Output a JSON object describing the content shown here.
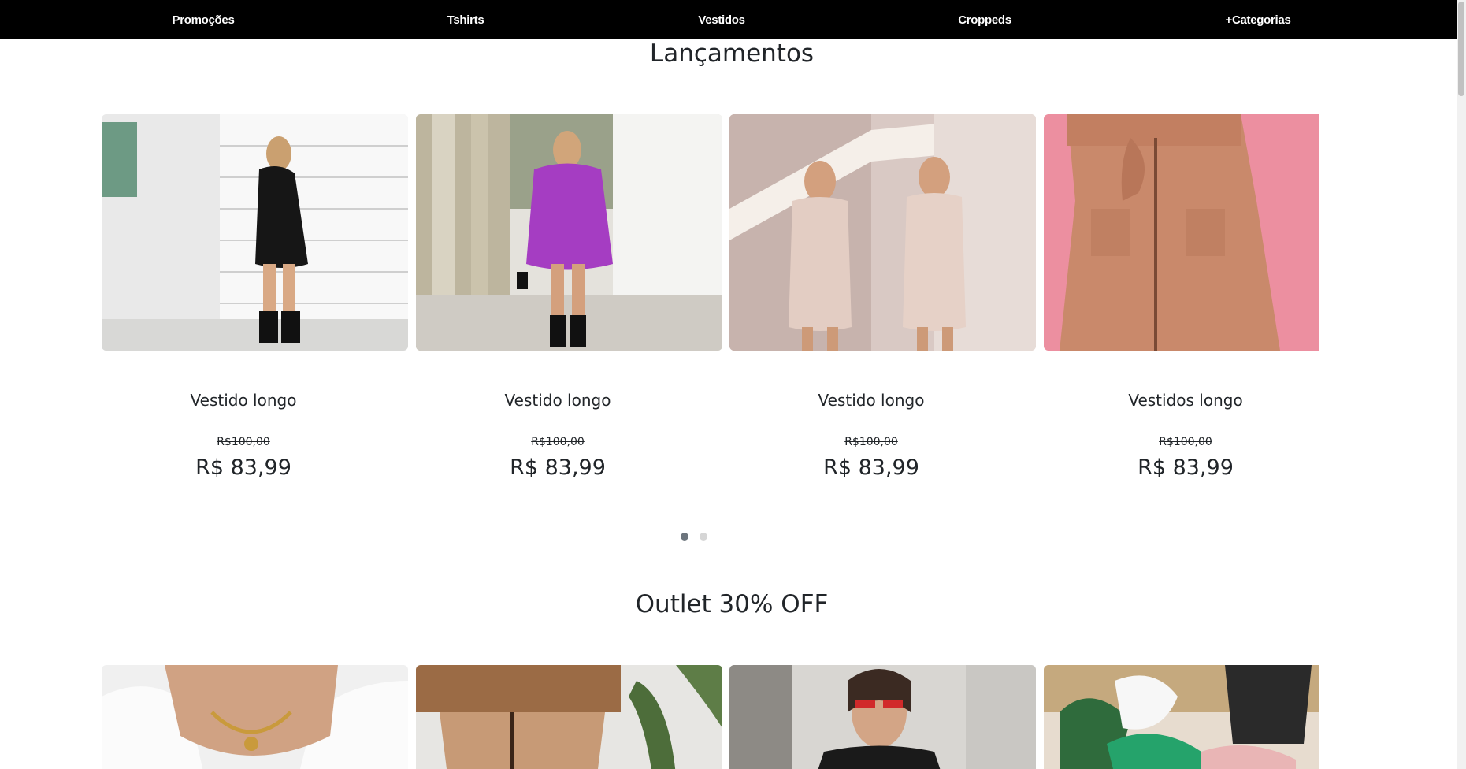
{
  "nav": {
    "items": [
      {
        "label": "Promoções"
      },
      {
        "label": "Tshirts"
      },
      {
        "label": "Vestidos"
      },
      {
        "label": "Croppeds"
      },
      {
        "label": "+Categorias"
      }
    ]
  },
  "launches": {
    "title": "Lançamentos",
    "products": [
      {
        "name": "Vestido longo",
        "old_price": "R$100,00",
        "price": "R$ 83,99"
      },
      {
        "name": "Vestido longo",
        "old_price": "R$100,00",
        "price": "R$ 83,99"
      },
      {
        "name": "Vestido longo",
        "old_price": "R$100,00",
        "price": "R$ 83,99"
      },
      {
        "name": "Vestidos longo",
        "old_price": "R$100,00",
        "price": "R$ 83,99"
      }
    ],
    "active_slide": 1,
    "slide_count": 2
  },
  "outlet": {
    "title": "Outlet 30% OFF"
  },
  "colors": {
    "nav_bg": "#000000",
    "nav_text": "#ffffff",
    "text": "#212529",
    "dot_active": "#6c757d",
    "dot_inactive": "#d6d6d6"
  }
}
